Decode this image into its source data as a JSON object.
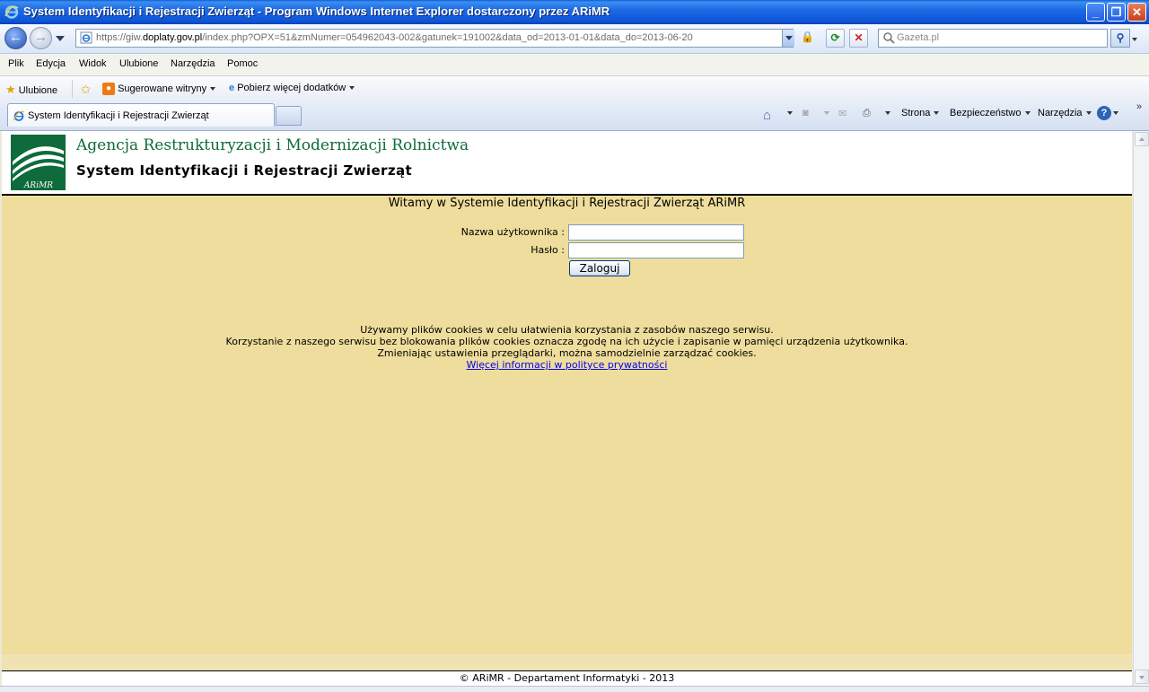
{
  "window": {
    "title": "System Identyfikacji i Rejestracji Zwierząt - Program Windows Internet Explorer dostarczony przez ARiMR",
    "buttons": [
      "minimize",
      "maximize",
      "close"
    ]
  },
  "addressbar": {
    "url_prefix": "https://giw.",
    "url_domain": "doplaty.gov.pl",
    "url_path": "/index.php?OPX=51&zmNumer=054962043-002&gatunek=191002&data_od=2013-01-01&data_do=2013-06-20",
    "search_placeholder": "Gazeta.pl",
    "icons": [
      "back-icon",
      "forward-icon",
      "lock-icon",
      "refresh-icon",
      "stop-icon",
      "search-icon"
    ]
  },
  "menubar": {
    "items": [
      "Plik",
      "Edycja",
      "Widok",
      "Ulubione",
      "Narzędzia",
      "Pomoc"
    ]
  },
  "favbar": {
    "favorites_label": "Ulubione",
    "suggested_label": "Sugerowane witryny",
    "addons_label": "Pobierz więcej dodatków"
  },
  "tabs": {
    "active_label": "System Identyfikacji i Rejestracji Zwierząt"
  },
  "commandbar": {
    "page_label": "Strona",
    "safety_label": "Bezpieczeństwo",
    "tools_label": "Narzędzia"
  },
  "site": {
    "agency_name": "Agencja Restrukturyzacji i Modernizacji Rolnictwa",
    "system_name": "System Identyfikacji i Rejestracji Zwierząt",
    "logo_text": "ARiMR",
    "brand_color": "#0f6b3b",
    "welcome": "Witamy w Systemie Identyfikacji i Rejestracji Zwierząt ARiMR",
    "login": {
      "username_label": "Nazwa użytkownika :",
      "username_value": "",
      "password_label": "Hasło :",
      "password_value": "",
      "submit_label": "Zaloguj"
    },
    "cookies": {
      "line1": "Używamy plików cookies w celu ułatwienia korzystania z zasobów naszego serwisu.",
      "line2": "Korzystanie z naszego serwisu bez blokowania plików cookies oznacza zgodę na ich użycie i zapisanie w pamięci urządzenia użytkownika.",
      "line3": "Zmieniając ustawienia przeglądarki, można samodzielnie zarządzać cookies.",
      "link": "Więcej informacji w polityce prywatności"
    },
    "footer": "© ARiMR - Departament Informatyki - 2013",
    "background_color": "#eedd9c"
  }
}
